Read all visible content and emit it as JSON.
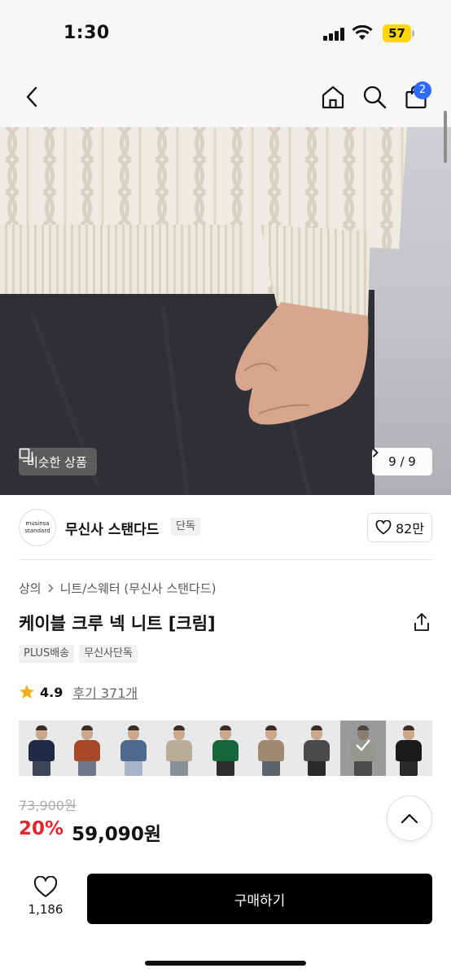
{
  "status_bar": {
    "time": "1:30",
    "battery": "57"
  },
  "header": {
    "cart_count": "2"
  },
  "gallery": {
    "similar_label": "비슷한 상품",
    "counter": "9 / 9"
  },
  "brand": {
    "logo_line1": "musinsa",
    "logo_line2": "standard",
    "name": "무신사 스탠다드",
    "tag": "단독",
    "likes": "82만"
  },
  "breadcrumb": [
    "상의",
    "니트/스웨터 (무신사 스탠다드)"
  ],
  "product": {
    "title": "케이블 크루 넥 니트 [크림]",
    "tags": [
      "PLUS배송",
      "무신사단독"
    ],
    "rating": "4.9",
    "reviews": "후기 371개",
    "original_price": "73,900원",
    "discount": "20%",
    "price": "59,090원"
  },
  "swatches": [
    {
      "color": "navy",
      "torso": "#1f2a44",
      "legs": "#3d4658"
    },
    {
      "color": "brick",
      "torso": "#a7482a",
      "legs": "#6d7788"
    },
    {
      "color": "slate-blue",
      "torso": "#4e6a8e",
      "legs": "#a7b4c6"
    },
    {
      "color": "oatmeal",
      "torso": "#b9ad98",
      "legs": "#8a9099"
    },
    {
      "color": "green",
      "torso": "#17653a",
      "legs": "#2d2d2f"
    },
    {
      "color": "beige",
      "torso": "#9e8a70",
      "legs": "#5d636d"
    },
    {
      "color": "charcoal",
      "torso": "#4a4a4d",
      "legs": "#2a2a2c"
    },
    {
      "color": "cream",
      "torso": "#e4e0d5",
      "legs": "#3a3b3f",
      "selected": true
    },
    {
      "color": "black",
      "torso": "#1b1b1c",
      "legs": "#2a2a2c"
    }
  ],
  "bottom_bar": {
    "wish_count": "1,186",
    "buy_label": "구매하기"
  },
  "colors": {
    "accent": "#e5242b",
    "badge": "#2f6bff",
    "buy_button": "#000000"
  }
}
